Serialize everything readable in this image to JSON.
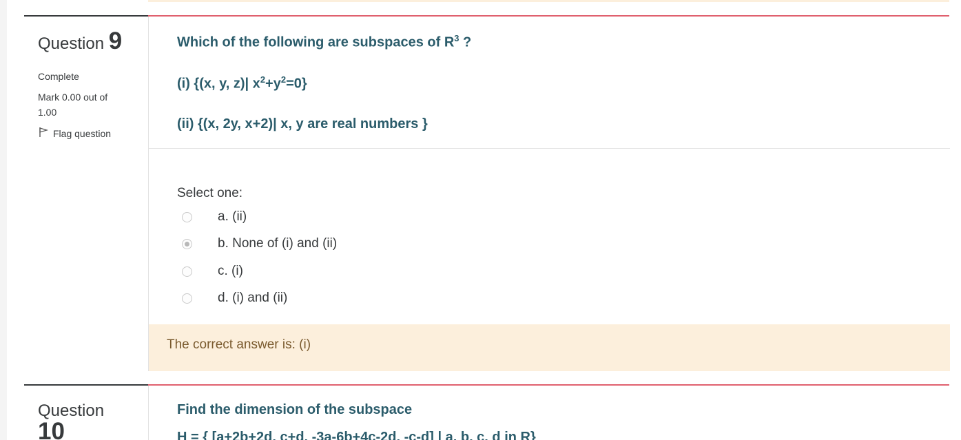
{
  "q9": {
    "label": "Question",
    "number": "9",
    "state": "Complete",
    "grade": "Mark 0.00 out of 1.00",
    "flag_label": "Flag question",
    "text_line1_a": "Which of the following are subspaces of R",
    "text_line1_sup": "3",
    "text_line1_b": " ?",
    "text_line2_a": "(i) {(x, y, z)| x",
    "text_line2_sup1": "2",
    "text_line2_b": "+y",
    "text_line2_sup2": "2",
    "text_line2_c": "=0}",
    "text_line3": "(ii) {(x, 2y, x+2)| x, y are real numbers }",
    "prompt": "Select one:",
    "answers": [
      {
        "label": "a. (ii)",
        "checked": false
      },
      {
        "label": "b. None of (i) and (ii)",
        "checked": true
      },
      {
        "label": "c. (i)",
        "checked": false
      },
      {
        "label": "d. (i) and (ii)",
        "checked": false
      }
    ],
    "correct_answer": "The correct answer is: (i)"
  },
  "q10": {
    "label": "Question",
    "number": "10",
    "text_line1": "Find the dimension of the subspace",
    "text_line2": "H = { [a+2b+2d, c+d, -3a-6b+4c-2d, -c-d] | a, b, c, d in R}"
  },
  "colors": {
    "question_text": "#2b5c6b",
    "accent_rule": "#e0606e",
    "feedback_bg": "#fcefdc"
  }
}
